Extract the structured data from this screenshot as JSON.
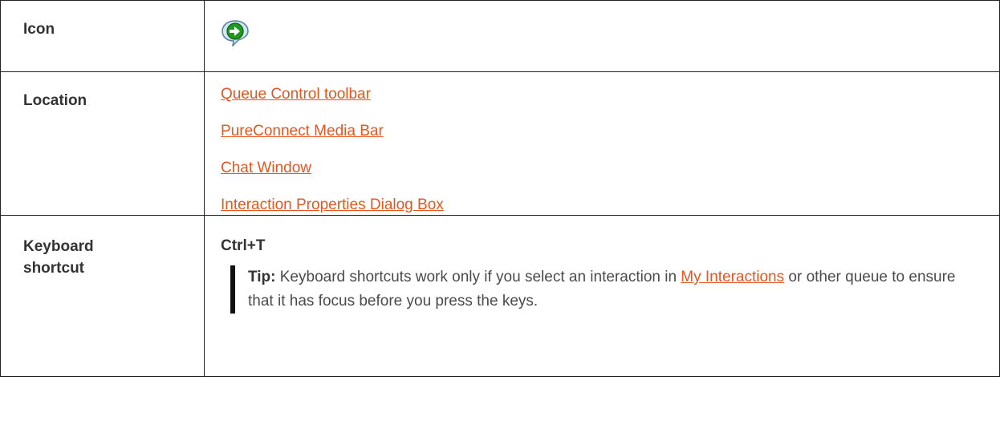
{
  "rows": {
    "icon": {
      "label": "Icon",
      "icon_name": "transfer-arrow-speech-bubble-icon"
    },
    "location": {
      "label": "Location",
      "links": [
        "Queue Control toolbar",
        "PureConnect Media Bar",
        "Chat Window",
        "Interaction Properties Dialog Box"
      ]
    },
    "keyboard": {
      "label_line1": "Keyboard",
      "label_line2": "shortcut",
      "shortcut": "Ctrl+T",
      "tip": {
        "label": "Tip:",
        "text_before": " Keyboard shortcuts work only if you select an interaction in ",
        "link": "My Interactions",
        "text_after": " or other queue to ensure that it has focus before you press the keys."
      }
    }
  },
  "colors": {
    "link": "#e8551e",
    "border": "#222222",
    "icon_arrow": "#1f9a1f",
    "icon_bubble": "#cfe6f5"
  }
}
